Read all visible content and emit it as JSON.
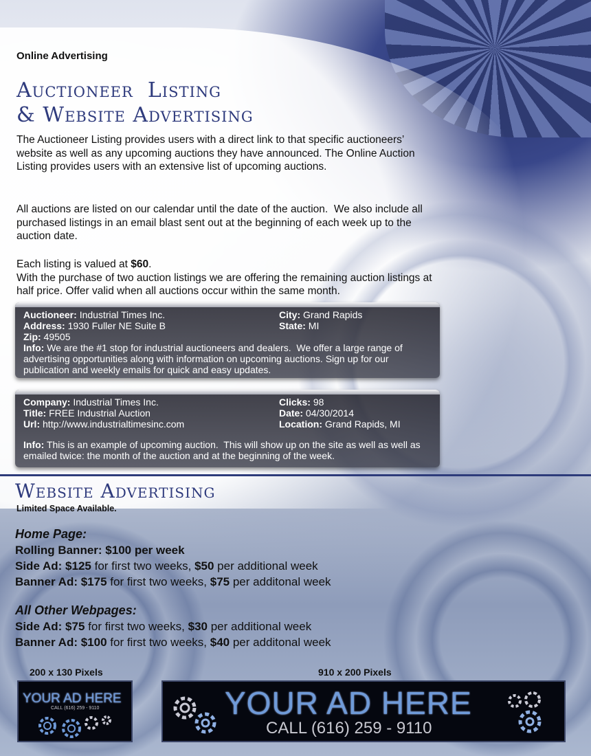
{
  "section_label": "Online Advertising",
  "main_title": [
    "Auctioneer  Listing",
    "& Website Advertising"
  ],
  "intro": "The Auctioneer Listing provides users with a direct link to that specific auctioneers’ website as well as any upcoming auctions they have announced. The Online Auction Listing provides users with an extensive list of upcoming auctions.",
  "calendar": "All auctions are listed on our calendar until the date of the auction.  We also include all purchased listings in an email blast sent out at the beginning of each week up to the auction date.",
  "pricing": {
    "line1_prefix": "Each listing is valued at ",
    "line1_price": "$60",
    "line1_suffix": ".",
    "line2": "With the purchase of two auction listings we are offering the remaining auction listings at half price. Offer valid when all auctions occur within the same month."
  },
  "auctioneer_card": {
    "auctioneer_label": "Auctioneer:",
    "auctioneer": "Industrial Times Inc.",
    "city_label": "City:",
    "city": "Grand Rapids",
    "address_label": "Address:",
    "address": "1930 Fuller NE Suite B",
    "state_label": "State:",
    "state": "MI",
    "zip_label": "Zip:",
    "zip": "49505",
    "info_label": "Info:",
    "info": "We are the #1 stop for industrial auctioneers and dealers.  We offer a large range of advertising opportunities along with information on upcoming auctions. Sign up for our publication and weekly emails for quick and easy updates."
  },
  "auction_card": {
    "company_label": "Company:",
    "company": "Industrial Times Inc.",
    "clicks_label": "Clicks:",
    "clicks": "98",
    "title_label": "Title:",
    "title": "FREE Industrial Auction",
    "date_label": "Date:",
    "date": "04/30/2014",
    "url_label": "Url:",
    "url": "http://www.industrialtimesinc.com",
    "location_label": "Location:",
    "location": "Grand Rapids, MI",
    "info_label": "Info:",
    "info": "This is an example of upcoming auction.  This will show up on the site as well as well as emailed twice: the month of the auction and at the beginning of the week."
  },
  "website_ad": {
    "title": "Website Advertising",
    "limited": "Limited Space Available.",
    "home": {
      "heading": "Home Page:",
      "lines": [
        {
          "key": "Rolling Banner: ",
          "v1": "$100 per week",
          "m1": "",
          "v2": "",
          "m2": ""
        },
        {
          "key": "Side Ad: ",
          "v1": "$125",
          "m1": " for first two weeks, ",
          "v2": "$50",
          "m2": " per additional week"
        },
        {
          "key": "Banner Ad: ",
          "v1": "$175",
          "m1": " for first two weeks, ",
          "v2": "$75",
          "m2": " per additonal week"
        }
      ]
    },
    "other": {
      "heading": "All Other Webpages:",
      "lines": [
        {
          "key": "Side Ad: ",
          "v1": "$75",
          "m1": " for first two weeks, ",
          "v2": "$30",
          "m2": " per additional week"
        },
        {
          "key": "Banner Ad: ",
          "v1": "$100",
          "m1": " for first two weeks, ",
          "v2": "$40",
          "m2": " per additonal week"
        }
      ]
    }
  },
  "ad_samples": {
    "small_size": "200 x 130 Pixels",
    "large_size": "910 x 200 Pixels",
    "small_title": "YOUR AD HERE",
    "small_call": "CALL (616) 259 - 9110",
    "large_title": "YOUR AD HERE",
    "large_call": "CALL (616) 259 - 9110",
    "accent_color": "#6f9ad8",
    "heading_color": "#2f3b7d"
  }
}
